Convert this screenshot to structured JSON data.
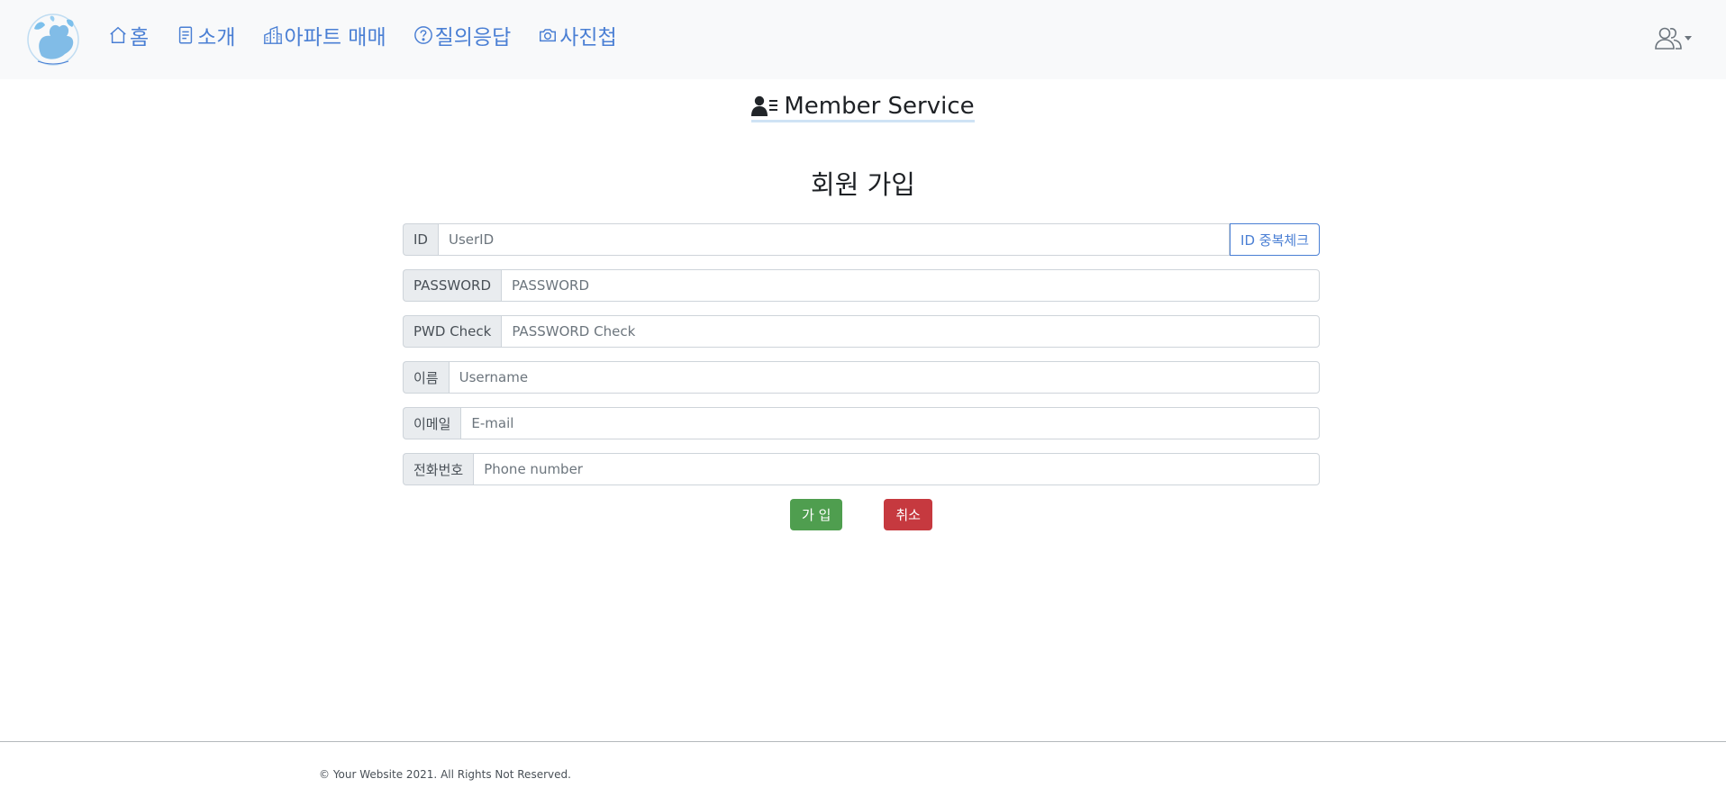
{
  "nav": {
    "logo_alt": "Happy Cat House",
    "items": [
      {
        "label": "홈",
        "icon": "home-icon"
      },
      {
        "label": "소개",
        "icon": "document-icon"
      },
      {
        "label": "아파트 매매",
        "icon": "building-icon"
      },
      {
        "label": "질의응답",
        "icon": "question-circle-icon"
      },
      {
        "label": "사진첩",
        "icon": "camera-icon"
      }
    ],
    "user_menu_icon": "users-icon"
  },
  "colors": {
    "nav_link": "#4a7fd4",
    "success": "#4f9e4f",
    "danger": "#c6393f"
  },
  "header": {
    "service_title": "Member Service"
  },
  "form": {
    "title": "회원 가입",
    "fields": {
      "id": {
        "label": "ID",
        "placeholder": "UserID",
        "value": "",
        "check_button": "ID 중복체크"
      },
      "password": {
        "label": "PASSWORD",
        "placeholder": "PASSWORD",
        "value": ""
      },
      "password_check": {
        "label": "PWD Check",
        "placeholder": "PASSWORD Check",
        "value": ""
      },
      "name": {
        "label": "이름",
        "placeholder": "Username",
        "value": ""
      },
      "email": {
        "label": "이메일",
        "placeholder": "E-mail",
        "value": ""
      },
      "phone": {
        "label": "전화번호",
        "placeholder": "Phone number",
        "value": ""
      }
    },
    "submit_label": "가 입",
    "cancel_label": "취소"
  },
  "footer": {
    "copyright": "© Your Website 2021. All Rights Not Reserved."
  }
}
